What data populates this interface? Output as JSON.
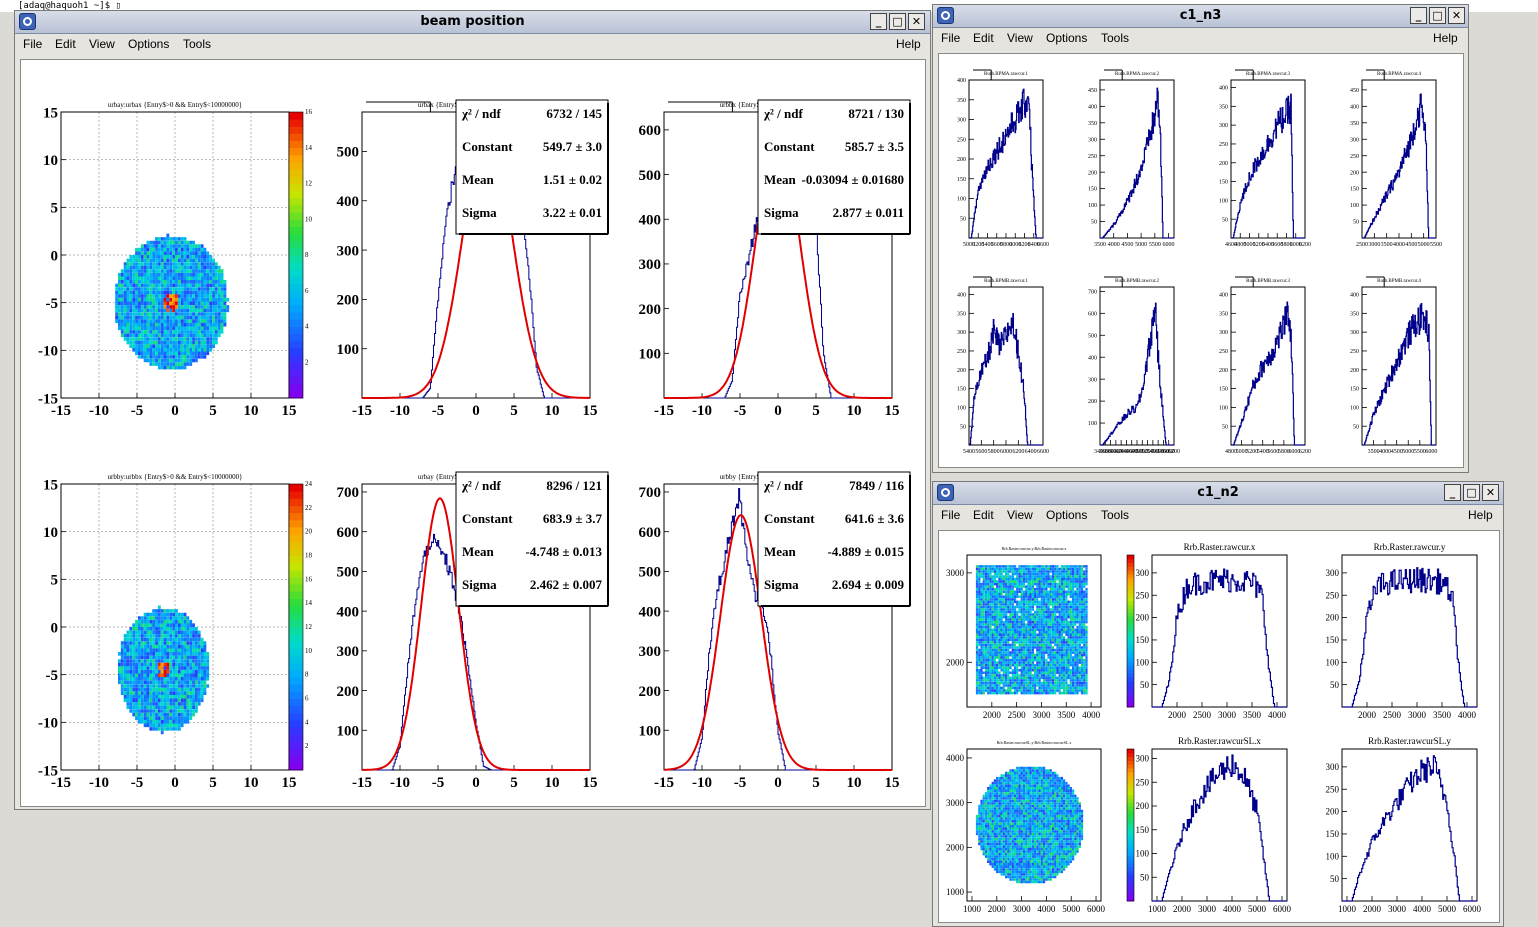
{
  "terminal": {
    "text": "[adaq@haquoh1 ~]$ ▯"
  },
  "menu": {
    "file": "File",
    "edit": "Edit",
    "view": "View",
    "options": "Options",
    "tools": "Tools",
    "help": "Help"
  },
  "windows": {
    "beam": {
      "title": "beam position"
    },
    "n3": {
      "title": "c1_n3"
    },
    "n2": {
      "title": "c1_n2"
    }
  },
  "colors": {
    "hist": "#00008b",
    "fit": "#e00000",
    "titlebar": "#c4ccdc"
  },
  "chart_data": [
    {
      "id": "bp2d1",
      "type": "heatmap",
      "title": "urbay:urbax {Entry$>0 && Entry$<10000000}",
      "xlim": [
        -15,
        15
      ],
      "ylim": [
        -15,
        15
      ],
      "xticks": [
        "-15",
        "-10",
        "-5",
        "0",
        "5",
        "10",
        "15"
      ],
      "yticks": [
        "-15",
        "-10",
        "-5",
        "0",
        "5",
        "10",
        "15"
      ],
      "zticks": [
        "2",
        "4",
        "6",
        "8",
        "10",
        "12",
        "14",
        "16"
      ],
      "blob": {
        "cx": -0.5,
        "cy": -5,
        "rx": 7.5,
        "ry": 7.0
      }
    },
    {
      "id": "bp2d2",
      "type": "heatmap",
      "title": "urbby:urbbx {Entry$>0 && Entry$<10000000}",
      "xlim": [
        -15,
        15
      ],
      "ylim": [
        -15,
        15
      ],
      "xticks": [
        "-15",
        "-10",
        "-5",
        "0",
        "5",
        "10",
        "15"
      ],
      "yticks": [
        "-15",
        "-10",
        "-5",
        "0",
        "5",
        "10",
        "15"
      ],
      "zticks": [
        "2",
        "4",
        "6",
        "8",
        "10",
        "12",
        "14",
        "16",
        "18",
        "20",
        "22",
        "24"
      ],
      "blob": {
        "cx": -1.5,
        "cy": -4.5,
        "rx": 6.0,
        "ry": 6.5
      }
    },
    {
      "id": "bph1",
      "type": "line",
      "title": "urbax {Entry$>0 && Entry$<10000000}",
      "xlim": [
        -15,
        15
      ],
      "ylim": [
        0,
        580
      ],
      "xticks": [
        "-15",
        "-10",
        "-5",
        "0",
        "5",
        "10",
        "15"
      ],
      "yticks": [
        "100",
        "200",
        "300",
        "400",
        "500"
      ],
      "x": [
        -7,
        -6,
        -5,
        -4,
        -3,
        -2,
        -1,
        0,
        1,
        2,
        3,
        4,
        5,
        6,
        7,
        8,
        9
      ],
      "values": [
        0,
        20,
        200,
        360,
        440,
        520,
        560,
        580,
        590,
        600,
        580,
        540,
        470,
        380,
        250,
        60,
        0
      ],
      "fit": {
        "constant": 549.7,
        "mean": 1.51,
        "sigma": 3.22
      },
      "stats": [
        [
          "χ² / ndf",
          "6732 / 145"
        ],
        [
          "Constant",
          "549.7 ± 3.0"
        ],
        [
          "Mean",
          "1.51 ± 0.02"
        ],
        [
          "Sigma",
          "3.22 ± 0.01"
        ]
      ]
    },
    {
      "id": "bph2",
      "type": "line",
      "title": "urbbx {Entry$>0 && Entry$<10000000}",
      "xlim": [
        -15,
        15
      ],
      "ylim": [
        0,
        640
      ],
      "xticks": [
        "-15",
        "-10",
        "-5",
        "0",
        "5",
        "10",
        "15"
      ],
      "yticks": [
        "100",
        "200",
        "300",
        "400",
        "500",
        "600"
      ],
      "x": [
        -7,
        -6,
        -5,
        -4,
        -3,
        -2,
        -1,
        0,
        1,
        2,
        3,
        4,
        5,
        6,
        7
      ],
      "values": [
        0,
        40,
        230,
        300,
        380,
        450,
        520,
        600,
        620,
        640,
        620,
        560,
        400,
        100,
        0
      ],
      "fit": {
        "constant": 585.7,
        "mean": -0.03094,
        "sigma": 2.877
      },
      "stats": [
        [
          "χ² / ndf",
          "8721 / 130"
        ],
        [
          "Constant",
          "585.7 ± 3.5"
        ],
        [
          "Mean",
          "-0.03094 ± 0.01680"
        ],
        [
          "Sigma",
          "2.877 ± 0.011"
        ]
      ]
    },
    {
      "id": "bph3",
      "type": "line",
      "title": "urbay {Entry$>0 && Entry$<10000000}",
      "xlim": [
        -15,
        15
      ],
      "ylim": [
        0,
        720
      ],
      "xticks": [
        "-15",
        "-10",
        "-5",
        "0",
        "5",
        "10",
        "15"
      ],
      "yticks": [
        "100",
        "200",
        "300",
        "400",
        "500",
        "600",
        "700"
      ],
      "x": [
        -11,
        -10,
        -9,
        -8,
        -7,
        -6,
        -5,
        -4,
        -3,
        -2,
        -1,
        0,
        1,
        2
      ],
      "values": [
        0,
        60,
        250,
        420,
        520,
        580,
        560,
        530,
        470,
        380,
        260,
        120,
        10,
        0
      ],
      "fit": {
        "constant": 683.9,
        "mean": -4.748,
        "sigma": 2.462
      },
      "stats": [
        [
          "χ² / ndf",
          "8296 / 121"
        ],
        [
          "Constant",
          "683.9 ± 3.7"
        ],
        [
          "Mean",
          "-4.748 ± 0.013"
        ],
        [
          "Sigma",
          "2.462 ± 0.007"
        ]
      ]
    },
    {
      "id": "bph4",
      "type": "line",
      "title": "urbby {Entry$>0 && Entry$<10000000}",
      "xlim": [
        -15,
        15
      ],
      "ylim": [
        0,
        720
      ],
      "xticks": [
        "-15",
        "-10",
        "-5",
        "0",
        "5",
        "10",
        "15"
      ],
      "yticks": [
        "100",
        "200",
        "300",
        "400",
        "500",
        "600",
        "700"
      ],
      "x": [
        -11,
        -10,
        -9,
        -8,
        -7,
        -6,
        -5,
        -4,
        -3,
        -2,
        -1,
        0,
        1
      ],
      "values": [
        0,
        80,
        300,
        450,
        530,
        620,
        690,
        520,
        440,
        420,
        300,
        100,
        0
      ],
      "fit": {
        "constant": 641.6,
        "mean": -4.889,
        "sigma": 2.694
      },
      "stats": [
        [
          "χ² / ndf",
          "7849 / 116"
        ],
        [
          "Constant",
          "641.6 ± 3.6"
        ],
        [
          "Mean",
          "-4.889 ± 0.015"
        ],
        [
          "Sigma",
          "2.694 ± 0.009"
        ]
      ]
    },
    {
      "id": "n3a1",
      "type": "line",
      "title": "Rurb.BPMA.rawcur.1",
      "xlim": [
        5000,
        6600
      ],
      "ylim": [
        0,
        400
      ],
      "xticks": [
        "5000",
        "5200",
        "5400",
        "5600",
        "5800",
        "6000",
        "6200",
        "6400",
        "6600"
      ],
      "yticks": [
        "50",
        "100",
        "150",
        "200",
        "250",
        "300",
        "350",
        "400"
      ],
      "x": [
        5050,
        5200,
        5400,
        5600,
        5800,
        6000,
        6200,
        6300,
        6350,
        6450
      ],
      "values": [
        0,
        120,
        180,
        220,
        260,
        300,
        340,
        360,
        200,
        0
      ]
    },
    {
      "id": "n3a2",
      "type": "line",
      "title": "Rurb.BPMA.rawcur.2",
      "xlim": [
        3500,
        6200
      ],
      "ylim": [
        0,
        480
      ],
      "xticks": [
        "3500",
        "4000",
        "4500",
        "5000",
        "5500",
        "6000"
      ],
      "yticks": [
        "50",
        "100",
        "150",
        "200",
        "250",
        "300",
        "350",
        "400",
        "450"
      ],
      "x": [
        3600,
        4000,
        4500,
        5000,
        5300,
        5500,
        5600,
        5700,
        5800
      ],
      "values": [
        0,
        40,
        110,
        210,
        300,
        370,
        430,
        330,
        0
      ]
    },
    {
      "id": "n3a3",
      "type": "line",
      "title": "Rurb.BPMA.rawcur.3",
      "xlim": [
        4600,
        6200
      ],
      "ylim": [
        0,
        420
      ],
      "xticks": [
        "4600",
        "4800",
        "5000",
        "5200",
        "5400",
        "5600",
        "5800",
        "6000",
        "6200"
      ],
      "yticks": [
        "50",
        "100",
        "150",
        "200",
        "250",
        "300",
        "350",
        "400"
      ],
      "x": [
        4650,
        4800,
        5000,
        5200,
        5400,
        5600,
        5800,
        5900,
        5950
      ],
      "values": [
        0,
        90,
        160,
        210,
        250,
        300,
        330,
        350,
        0
      ]
    },
    {
      "id": "n3a4",
      "type": "line",
      "title": "Rurb.BPMA.rawcur.4",
      "xlim": [
        2500,
        5500
      ],
      "ylim": [
        0,
        480
      ],
      "xticks": [
        "2500",
        "3000",
        "3500",
        "4000",
        "4500",
        "5000",
        "5500"
      ],
      "yticks": [
        "50",
        "100",
        "150",
        "200",
        "250",
        "300",
        "350",
        "400",
        "450"
      ],
      "x": [
        2600,
        3000,
        3500,
        4000,
        4500,
        4700,
        4900,
        5100,
        5200
      ],
      "values": [
        0,
        60,
        130,
        200,
        300,
        360,
        400,
        300,
        0
      ]
    },
    {
      "id": "n3b1",
      "type": "line",
      "title": "Rurb.BPMB.rawcur.1",
      "xlim": [
        5400,
        6600
      ],
      "ylim": [
        0,
        420
      ],
      "xticks": [
        "5400",
        "5600",
        "5800",
        "6000",
        "6200",
        "6400",
        "6600"
      ],
      "yticks": [
        "50",
        "100",
        "150",
        "200",
        "250",
        "300",
        "350",
        "400"
      ],
      "x": [
        5420,
        5500,
        5700,
        5800,
        5900,
        6000,
        6100,
        6200,
        6300,
        6350
      ],
      "values": [
        0,
        150,
        230,
        300,
        260,
        290,
        330,
        250,
        130,
        0
      ]
    },
    {
      "id": "n3b2",
      "type": "line",
      "title": "Rurb.BPMB.rawcur.2",
      "xlim": [
        3400,
        6200
      ],
      "ylim": [
        0,
        720
      ],
      "xticks": [
        "3400",
        "3600",
        "3800",
        "4000",
        "4200",
        "4400",
        "4600",
        "4800",
        "5000",
        "5200",
        "5400",
        "5600",
        "5800",
        "6000",
        "6200"
      ],
      "yticks": [
        "100",
        "200",
        "300",
        "400",
        "500",
        "600",
        "700"
      ],
      "x": [
        3500,
        4000,
        4500,
        4800,
        5000,
        5200,
        5400,
        5500,
        5600,
        5700,
        5900
      ],
      "values": [
        0,
        80,
        150,
        170,
        250,
        400,
        550,
        650,
        400,
        250,
        0
      ]
    },
    {
      "id": "n3b3",
      "type": "line",
      "title": "Rurb.BPMB.rawcur.3",
      "xlim": [
        4800,
        6200
      ],
      "ylim": [
        0,
        420
      ],
      "xticks": [
        "4800",
        "5000",
        "5200",
        "5400",
        "5600",
        "5800",
        "6000",
        "6200"
      ],
      "yticks": [
        "50",
        "100",
        "150",
        "200",
        "250",
        "300",
        "350",
        "400"
      ],
      "x": [
        4850,
        5000,
        5200,
        5400,
        5600,
        5800,
        5900,
        5950,
        6000
      ],
      "values": [
        0,
        60,
        150,
        210,
        250,
        320,
        350,
        250,
        0
      ]
    },
    {
      "id": "n3b4",
      "type": "line",
      "title": "Rurb.BPMB.rawcur.4",
      "xlim": [
        3000,
        6200
      ],
      "ylim": [
        0,
        420
      ],
      "xticks": [
        "3500",
        "4000",
        "4500",
        "5000",
        "5500",
        "6000"
      ],
      "yticks": [
        "50",
        "100",
        "150",
        "200",
        "250",
        "300",
        "350",
        "400"
      ],
      "x": [
        3100,
        3500,
        4000,
        4500,
        5000,
        5400,
        5700,
        5900,
        6000
      ],
      "values": [
        0,
        80,
        150,
        220,
        290,
        330,
        340,
        300,
        0
      ]
    },
    {
      "id": "n2s1",
      "type": "heatmap",
      "title": "Rrb.Raster.rawcur.y:Rrb.Raster.rawcur.x",
      "xlim": [
        1500,
        4200
      ],
      "ylim": [
        1500,
        3200
      ],
      "xticks": [
        "2000",
        "2500",
        "3000",
        "3500",
        "4000"
      ],
      "yticks": [
        "1000",
        "2000",
        "3000"
      ],
      "shape": "square"
    },
    {
      "id": "n2h1",
      "type": "line",
      "title": "Rrb.Raster.rawcur.x",
      "xlim": [
        1500,
        4200
      ],
      "ylim": [
        0,
        340
      ],
      "xticks": [
        "2000",
        "2500",
        "3000",
        "3500",
        "4000"
      ],
      "yticks": [
        "50",
        "100",
        "150",
        "200",
        "250",
        "300"
      ],
      "x": [
        1700,
        1850,
        2000,
        2200,
        2500,
        3000,
        3500,
        3700,
        3850,
        3950
      ],
      "values": [
        0,
        60,
        200,
        270,
        280,
        285,
        280,
        250,
        80,
        0
      ]
    },
    {
      "id": "n2h2",
      "type": "line",
      "title": "Rrb.Raster.rawcur.y",
      "xlim": [
        1500,
        4200
      ],
      "ylim": [
        0,
        340
      ],
      "xticks": [
        "2000",
        "2500",
        "3000",
        "3500",
        "4000"
      ],
      "yticks": [
        "50",
        "100",
        "150",
        "200",
        "250",
        "300"
      ],
      "x": [
        1700,
        1850,
        2000,
        2200,
        2500,
        3000,
        3500,
        3700,
        3850,
        3950
      ],
      "values": [
        0,
        60,
        200,
        270,
        280,
        285,
        280,
        250,
        80,
        0
      ]
    },
    {
      "id": "n2s2",
      "type": "heatmap",
      "title": "Rrb.Raster.rawcurSL.y:Rrb.Raster.rawcurSL.x",
      "xlim": [
        800,
        6200
      ],
      "ylim": [
        800,
        4200
      ],
      "xticks": [
        "1000",
        "2000",
        "3000",
        "4000",
        "5000",
        "6000"
      ],
      "yticks": [
        "1000",
        "2000",
        "3000",
        "4000"
      ],
      "shape": "circle"
    },
    {
      "id": "n2h3",
      "type": "line",
      "title": "Rrb.Raster.rawcurSL.x",
      "xlim": [
        800,
        6200
      ],
      "ylim": [
        0,
        320
      ],
      "xticks": [
        "1000",
        "2000",
        "3000",
        "4000",
        "5000",
        "6000"
      ],
      "yticks": [
        "50",
        "100",
        "150",
        "200",
        "250",
        "300"
      ],
      "x": [
        1200,
        1500,
        2000,
        2500,
        3000,
        3500,
        4000,
        4500,
        5000,
        5300,
        5500
      ],
      "values": [
        0,
        60,
        140,
        200,
        240,
        270,
        290,
        260,
        190,
        80,
        0
      ]
    },
    {
      "id": "n2h4",
      "type": "line",
      "title": "Rrb.Raster.rawcurSL.y",
      "xlim": [
        800,
        6200
      ],
      "ylim": [
        0,
        340
      ],
      "xticks": [
        "1000",
        "2000",
        "3000",
        "4000",
        "5000",
        "6000"
      ],
      "yticks": [
        "50",
        "100",
        "150",
        "200",
        "250",
        "300"
      ],
      "x": [
        1200,
        1500,
        2000,
        2500,
        3000,
        3500,
        4000,
        4500,
        5000,
        5300,
        5500
      ],
      "values": [
        0,
        60,
        130,
        180,
        220,
        260,
        290,
        300,
        220,
        100,
        0
      ]
    }
  ]
}
